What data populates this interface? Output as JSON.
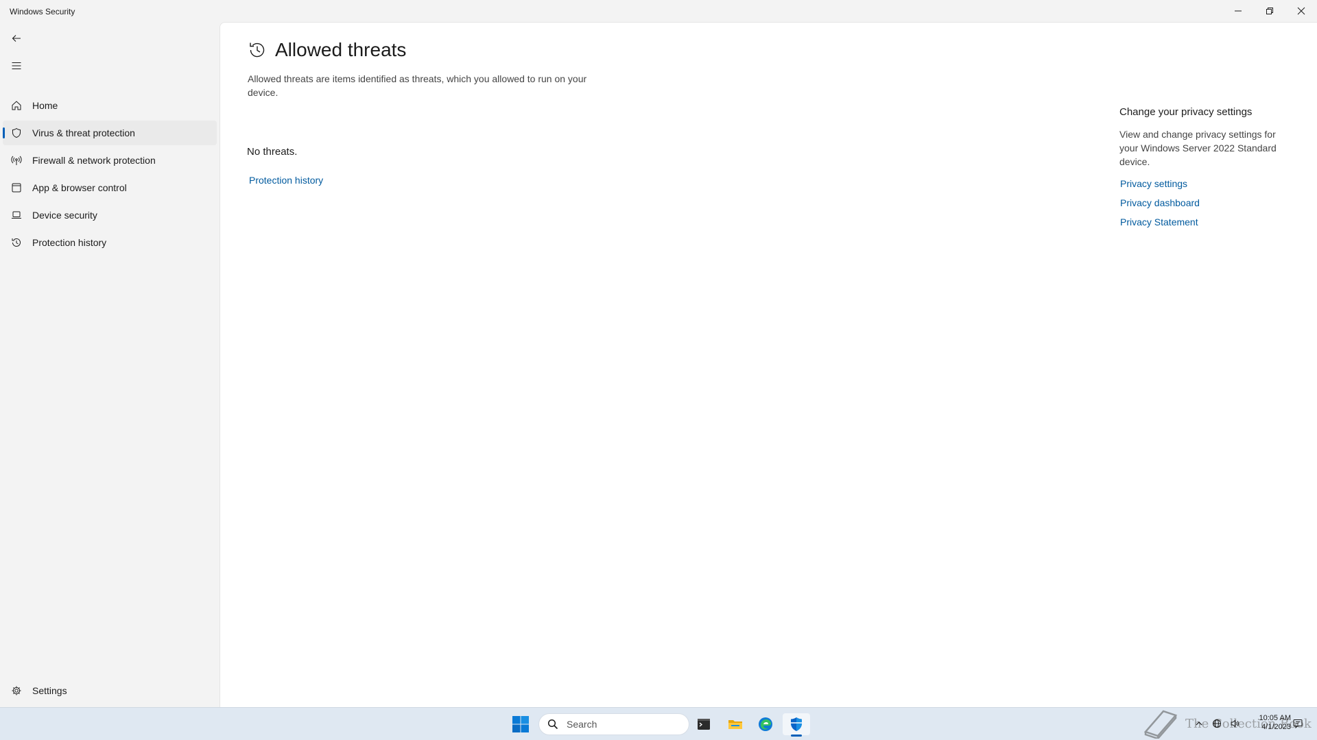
{
  "window": {
    "title": "Windows Security",
    "controls": {
      "minimize": "minimize-icon",
      "restore": "restore-icon",
      "close": "close-icon"
    }
  },
  "sidebar": {
    "back_icon": "back-arrow-icon",
    "menu_icon": "hamburger-menu-icon",
    "items": [
      {
        "label": "Home",
        "icon": "home-icon",
        "active": false
      },
      {
        "label": "Virus & threat protection",
        "icon": "shield-icon",
        "active": true
      },
      {
        "label": "Firewall & network protection",
        "icon": "antenna-icon",
        "active": false
      },
      {
        "label": "App & browser control",
        "icon": "app-window-icon",
        "active": false
      },
      {
        "label": "Device security",
        "icon": "laptop-icon",
        "active": false
      },
      {
        "label": "Protection history",
        "icon": "history-icon",
        "active": false
      }
    ],
    "settings": {
      "label": "Settings",
      "icon": "gear-icon"
    }
  },
  "main": {
    "title": "Allowed threats",
    "title_icon": "history-icon",
    "description": "Allowed threats are items identified as threats, which you allowed to run on your device.",
    "status": "No threats.",
    "history_link": "Protection history"
  },
  "privacy": {
    "heading": "Change your privacy settings",
    "description": "View and change privacy settings for your Windows Server 2022 Standard device.",
    "links": [
      "Privacy settings",
      "Privacy dashboard",
      "Privacy Statement"
    ]
  },
  "taskbar": {
    "search_placeholder": "Search",
    "apps": [
      "start-icon",
      "terminal-icon",
      "file-explorer-icon",
      "edge-icon",
      "windows-security-icon"
    ],
    "active_app": "windows-security-icon",
    "watermark": "The Collection Book",
    "time": "10:05 AM",
    "date": "4/1/2023"
  },
  "colors": {
    "accent": "#005fb8",
    "link": "#005a9e",
    "sidebar_bg": "#f3f3f3",
    "content_bg": "#ffffff",
    "taskbar_bg": "#dfe8f2"
  }
}
